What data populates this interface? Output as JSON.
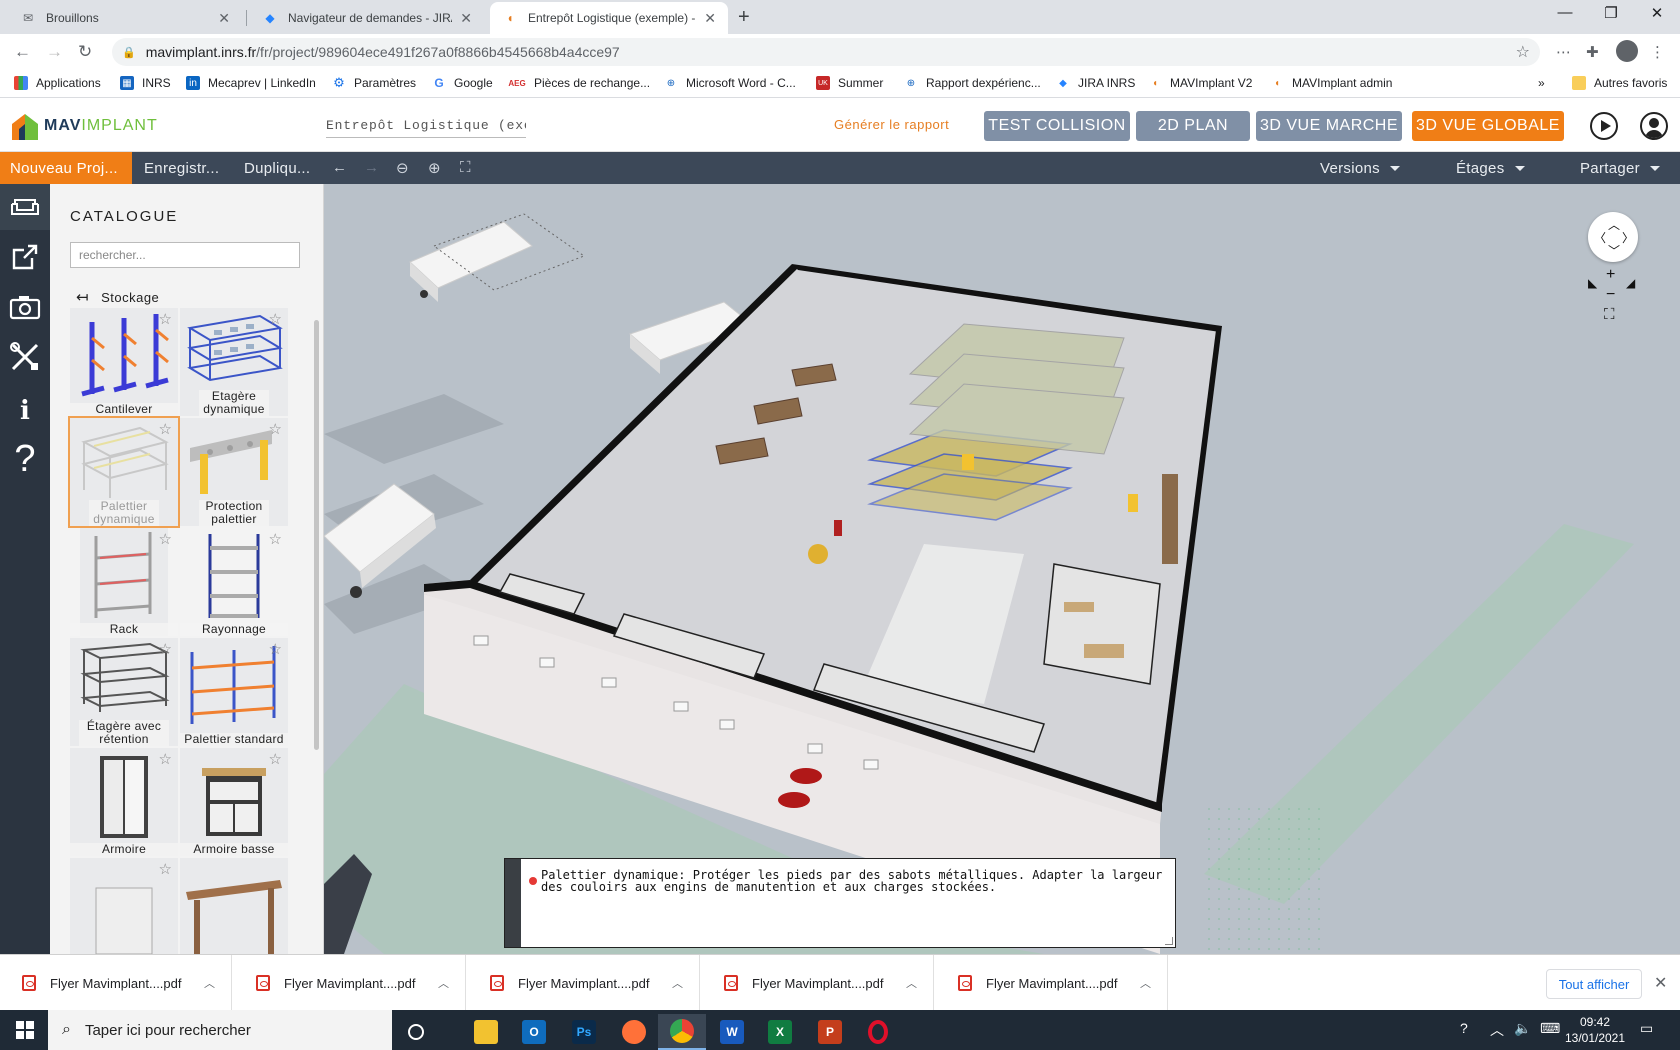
{
  "browser": {
    "tabs": [
      {
        "label": "Brouillons",
        "icon": "gmail-icon"
      },
      {
        "label": "Navigateur de demandes - JIRA II",
        "icon": "jira-icon"
      },
      {
        "label": "Entrepôt Logistique (exemple) - I",
        "icon": "mavimplant-icon"
      }
    ],
    "url_host": "mavimplant.inrs.fr",
    "url_path": "/fr/project/989604ece491f267a0f8866b4545668b4a4cce97",
    "bookmarks": [
      "Applications",
      "INRS",
      "Mecaprev | LinkedIn",
      "Paramètres",
      "Google",
      "Pièces de rechange...",
      "Microsoft Word - C...",
      "Summer",
      "Rapport dexpérienc...",
      "JIRA INRS",
      "MAVImplant V2",
      "MAVImplant admin"
    ],
    "other_bookmarks": "Autres favoris",
    "more": "»"
  },
  "app": {
    "logo_part1": "MAV",
    "logo_part2": "IMPLANT",
    "project_name": "Entrepôt Logistique (exemple",
    "generate_report": "Générer le rapport",
    "view_buttons": [
      "TEST COLLISION",
      "2D PLAN",
      "3D VUE MARCHE",
      "3D VUE GLOBALE"
    ],
    "active_view": "3D VUE GLOBALE",
    "menu": {
      "new_project": "Nouveau Proj...",
      "save": "Enregistr...",
      "duplicate": "Dupliqu...",
      "versions": "Versions",
      "floors": "Étages",
      "share": "Partager"
    }
  },
  "catalogue": {
    "title": "CATALOGUE",
    "search_placeholder": "rechercher...",
    "category": "Stockage",
    "items": [
      {
        "name": "Cantilever"
      },
      {
        "name": "Etagère dynamique"
      },
      {
        "name": "Palettier dynamique",
        "selected": true
      },
      {
        "name": "Protection palettier"
      },
      {
        "name": "Rack"
      },
      {
        "name": "Rayonnage"
      },
      {
        "name": "Étagère avec rétention"
      },
      {
        "name": "Palettier standard"
      },
      {
        "name": "Armoire"
      },
      {
        "name": "Armoire basse"
      },
      {
        "name": ""
      },
      {
        "name": ""
      }
    ]
  },
  "warning": {
    "text": "Palettier dynamique: Protéger les pieds par des sabots métalliques. Adapter la largeur des couloirs aux engins de manutention et aux charges stockées.",
    "level_color": "#e53935"
  },
  "downloads": {
    "files": [
      "Flyer Mavimplant....pdf",
      "Flyer Mavimplant....pdf",
      "Flyer Mavimplant....pdf",
      "Flyer Mavimplant....pdf",
      "Flyer Mavimplant....pdf"
    ],
    "show_all": "Tout afficher"
  },
  "taskbar": {
    "search_placeholder": "Taper ici pour rechercher",
    "time": "09:42",
    "date": "13/01/2021"
  },
  "colors": {
    "accent": "#f07e16",
    "view_button": "#8090a6",
    "menubar": "#3c4858",
    "sidebar": "#2b3440"
  }
}
